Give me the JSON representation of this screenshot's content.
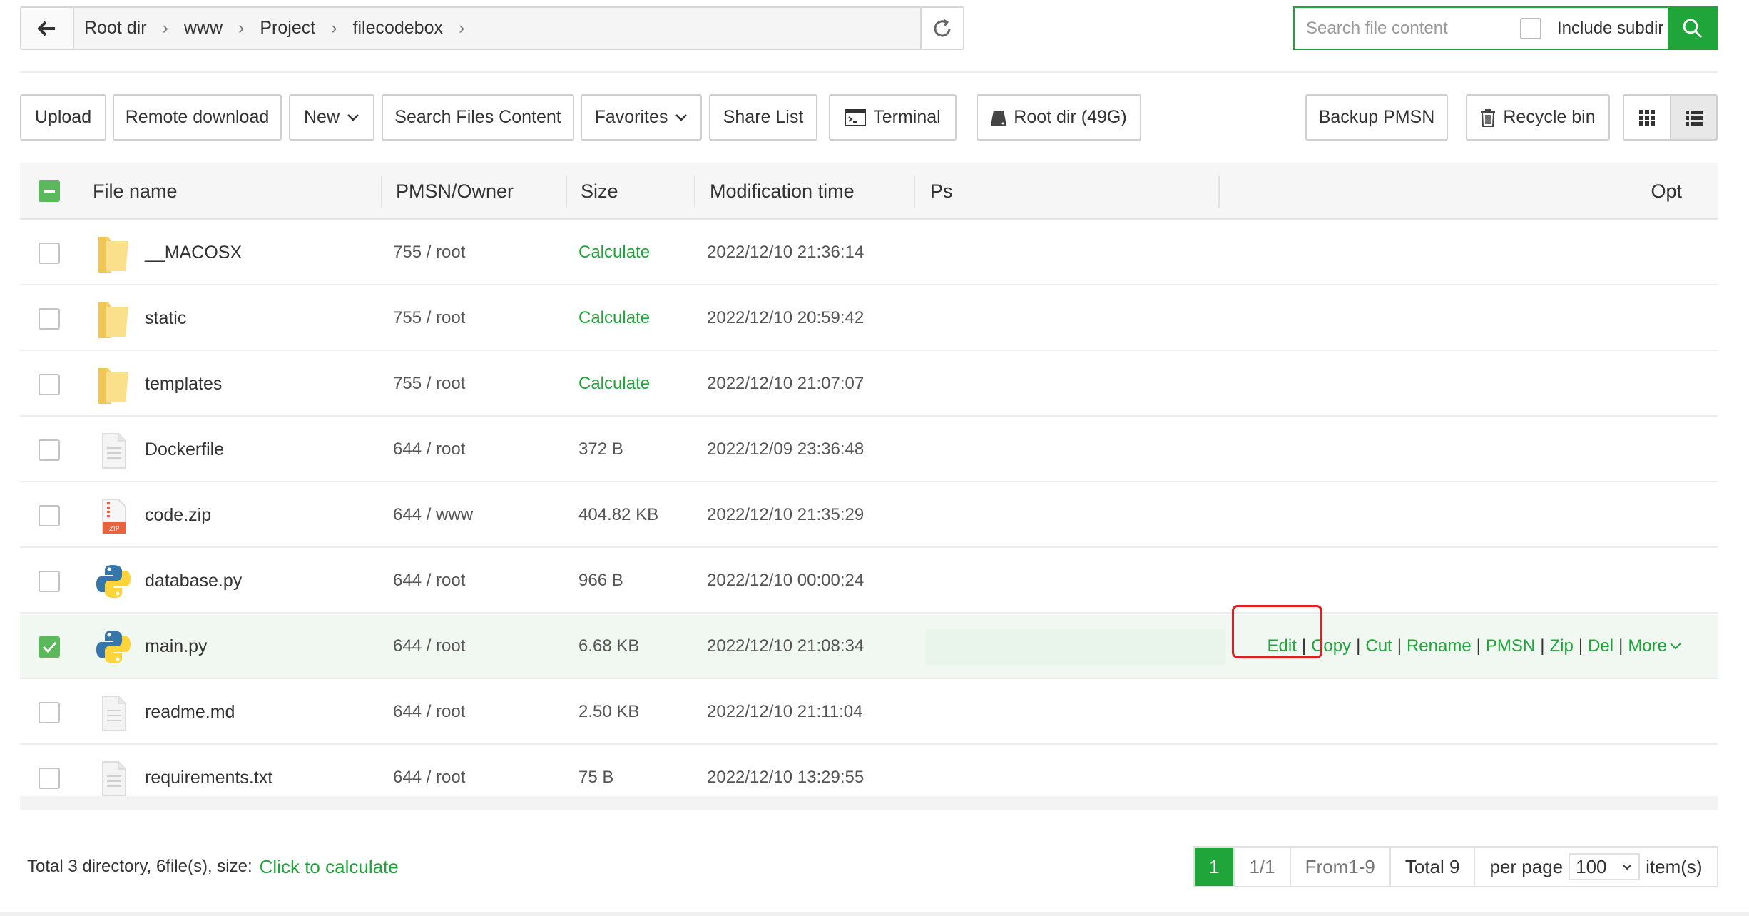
{
  "breadcrumbs": [
    "Root dir",
    "www",
    "Project",
    "filecodebox"
  ],
  "search": {
    "placeholder": "Search file content",
    "include_subdir_label": "Include subdir"
  },
  "toolbar": {
    "upload": "Upload",
    "remote_download": "Remote download",
    "new": "New",
    "search_files_content": "Search Files Content",
    "favorites": "Favorites",
    "share_list": "Share List",
    "terminal": "Terminal",
    "root_dir": "Root dir (49G)",
    "backup_pmsn": "Backup PMSN",
    "recycle_bin": "Recycle bin"
  },
  "table": {
    "headers": {
      "name": "File name",
      "owner": "PMSN/Owner",
      "size": "Size",
      "mtime": "Modification time",
      "ps": "Ps",
      "opt": "Opt"
    },
    "rows": [
      {
        "name": "__MACOSX",
        "owner": "755 / root",
        "size": "Calculate",
        "mtime": "2022/12/10 21:36:14",
        "icon": "folder-icon",
        "size_is_link": true,
        "selected": false
      },
      {
        "name": "static",
        "owner": "755 / root",
        "size": "Calculate",
        "mtime": "2022/12/10 20:59:42",
        "icon": "folder-icon",
        "size_is_link": true,
        "selected": false
      },
      {
        "name": "templates",
        "owner": "755 / root",
        "size": "Calculate",
        "mtime": "2022/12/10 21:07:07",
        "icon": "folder-icon",
        "size_is_link": true,
        "selected": false
      },
      {
        "name": "Dockerfile",
        "owner": "644 / root",
        "size": "372 B",
        "mtime": "2022/12/09 23:36:48",
        "icon": "text-file-icon",
        "selected": false
      },
      {
        "name": "code.zip",
        "owner": "644 / www",
        "size": "404.82 KB",
        "mtime": "2022/12/10 21:35:29",
        "icon": "zip-file-icon",
        "selected": false
      },
      {
        "name": "database.py",
        "owner": "644 / root",
        "size": "966 B",
        "mtime": "2022/12/10 00:00:24",
        "icon": "python-icon",
        "selected": false
      },
      {
        "name": "main.py",
        "owner": "644 / root",
        "size": "6.68 KB",
        "mtime": "2022/12/10 21:08:34",
        "icon": "python-icon",
        "selected": true
      },
      {
        "name": "readme.md",
        "owner": "644 / root",
        "size": "2.50 KB",
        "mtime": "2022/12/10 21:11:04",
        "icon": "text-file-icon",
        "selected": false
      },
      {
        "name": "requirements.txt",
        "owner": "644 / root",
        "size": "75 B",
        "mtime": "2022/12/10 13:29:55",
        "icon": "text-file-icon",
        "selected": false
      }
    ],
    "row_ops": [
      "Edit",
      "Copy",
      "Cut",
      "Rename",
      "PMSN",
      "Zip",
      "Del",
      "More"
    ]
  },
  "footer": {
    "summary": "Total 3 directory, 6file(s), size:",
    "calc_link": "Click to calculate",
    "pager": {
      "current": "1",
      "pages": "1/1",
      "range": "From1-9",
      "total": "Total 9",
      "per_page_label": "per page",
      "per_page_value": "100",
      "items_label": "item(s)"
    }
  },
  "colors": {
    "accent": "#20a53a",
    "highlight": "#e02020"
  }
}
